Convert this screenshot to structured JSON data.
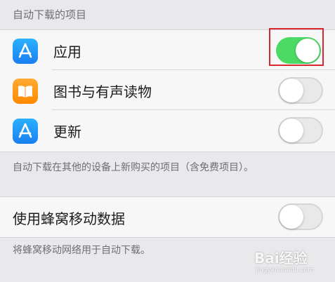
{
  "section_header": "自动下载的项目",
  "auto_download_items": [
    {
      "label": "应用",
      "icon": "app-store-icon",
      "enabled": true
    },
    {
      "label": "图书与有声读物",
      "icon": "books-icon",
      "enabled": false
    },
    {
      "label": "更新",
      "icon": "app-store-icon",
      "enabled": false
    }
  ],
  "auto_download_footnote": "自动下载在其他的设备上新购买的项目（含免费项目）。",
  "cellular": {
    "label": "使用蜂窝移动数据",
    "enabled": false,
    "footnote": "将蜂窝移动网络用于自动下载。"
  },
  "watermark": {
    "logo": "Bai经验",
    "sub": "jingyan.baidu.com"
  },
  "colors": {
    "toggle_on": "#4cd964",
    "highlight": "#d9272e",
    "app_store_blue": "#1a7ff0",
    "books_orange": "#ff8a00"
  }
}
